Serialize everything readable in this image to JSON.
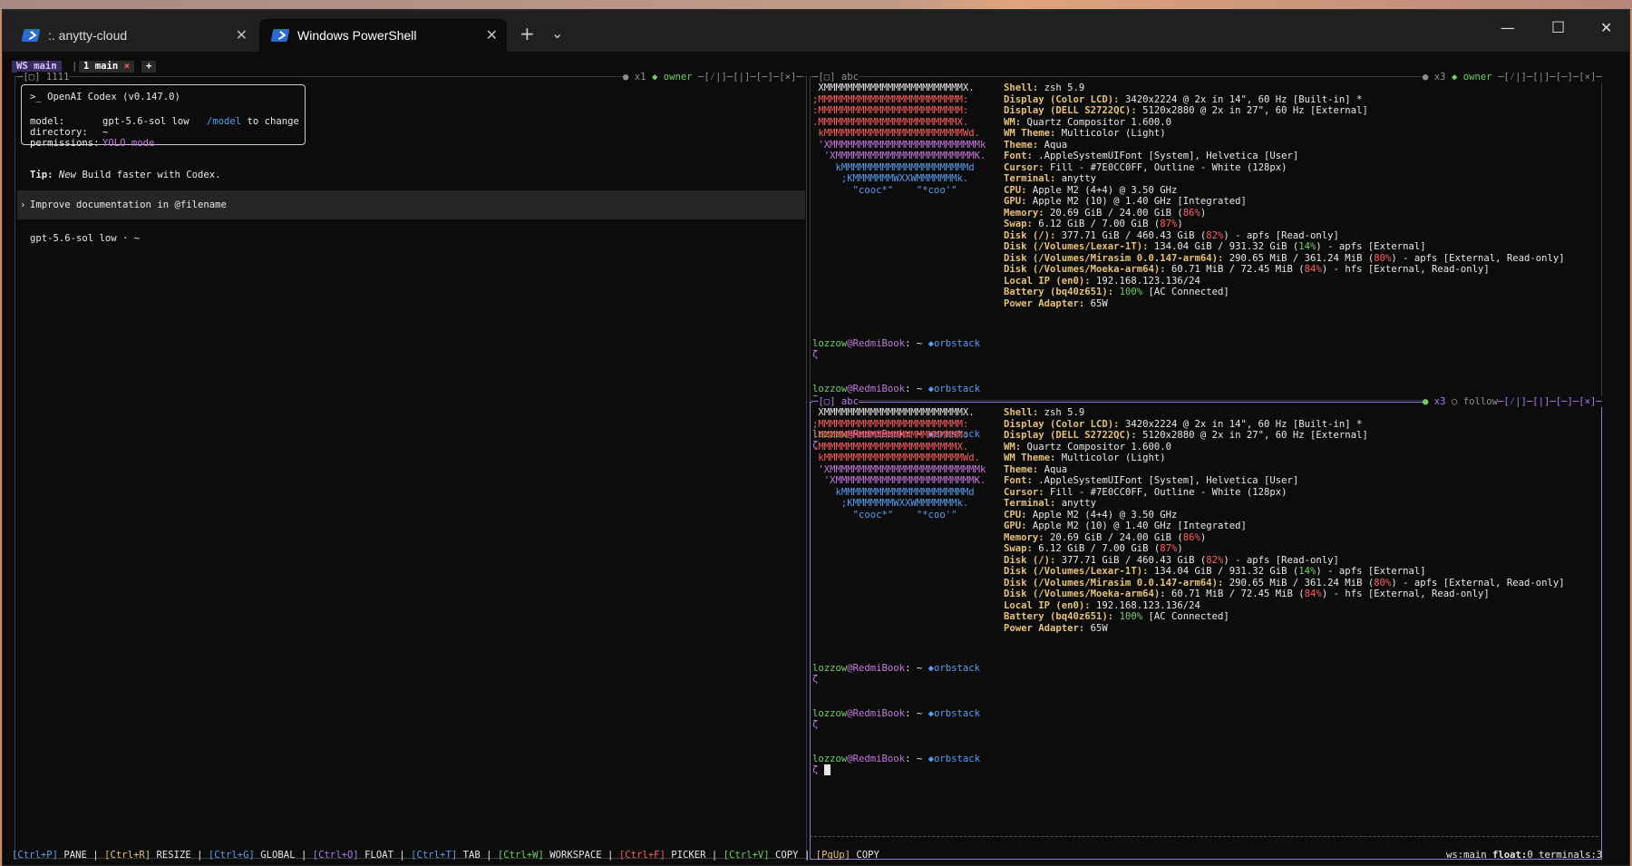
{
  "tabs": [
    {
      "label": "anytty-cloud",
      "prefix": ":."
    },
    {
      "label": "Windows PowerShell"
    }
  ],
  "icons": {
    "tab_close": "✕",
    "new_tab": "+",
    "dropdown": "⌄",
    "minimize": "—",
    "maximize": "☐",
    "close": "✕"
  },
  "workspace": {
    "ws_label": "WS main",
    "sep": "|",
    "tab_label": "1 main",
    "tab_close": "×",
    "add": "+"
  },
  "left_pane": {
    "title": "─[▢] 1111",
    "status_dot": "●",
    "meta": "x1",
    "role_glyph": "◆",
    "role": "owner",
    "controls": "─[⁄|]─[|]─[─]─[×]─",
    "codex": {
      "prompt": ">_",
      "title": "OpenAI Codex (v0.147.0)",
      "model_key": "model:",
      "model_val": "gpt-5.6-sol low",
      "model_cmd": "/model",
      "model_hint": "to change",
      "dir_key": "directory:",
      "dir_val": "~",
      "perm_key": "permissions:",
      "perm_val": "YOLO mode"
    },
    "tip_key": "Tip:",
    "tip_new": "New",
    "tip_text": "Build faster with Codex.",
    "suggest_chevron": "›",
    "suggestion": "Improve documentation in @filename",
    "footer": "gpt-5.6-sol low · ~"
  },
  "right_top": {
    "title": "─[▢] abc",
    "status_dot": "●",
    "meta": "x3",
    "role_glyph": "◆",
    "role": "owner",
    "controls": "─[⁄|]─[|]─[─]─[×]─"
  },
  "right_bottom": {
    "title": "─[▢] abc",
    "status_dot": "●",
    "meta": "x3",
    "role_glyph": "○",
    "role": "follow",
    "controls": "─[⁄|]─[|]─[─]─[×]─"
  },
  "ascii": [
    {
      "t": " XMMMMMMMMMMMMMMMMMMMMMMMMX.",
      "c": "white"
    },
    {
      "t": ";MMMMMMMMMMMMMMMMMMMMMMMMM:",
      "c": "red"
    },
    {
      "t": ":MMMMMMMMMMMMMMMMMMMMMMMMM:",
      "c": "red"
    },
    {
      "t": ".MMMMMMMMMMMMMMMMMMMMMMMMX.",
      "c": "red"
    },
    {
      "t": " kMMMMMMMMMMMMMMMMMMMMMMMMWd.",
      "c": "red"
    },
    {
      "t": " 'XMMMMMMMMMMMMMMMMMMMMMMMMMMk",
      "c": "mag"
    },
    {
      "t": "  'XMMMMMMMMMMMMMMMMMMMMMMMMK.",
      "c": "mag"
    },
    {
      "t": "    kMMMMMMMMMMMMMMMMMMMMMMd",
      "c": "blu"
    },
    {
      "t": "     ;KMMMMMMMWXXWMMMMMMMk.",
      "c": "blu"
    },
    {
      "t": "       \"cooc*\"    \"*coo'\"",
      "c": "blu"
    }
  ],
  "sysinfo": [
    {
      "k": "Shell:",
      "v": " zsh 5.9"
    },
    {
      "k": "Display (Color LCD):",
      "v": " 3420x2224 @ 2x in 14\", 60 Hz [Built-in] *"
    },
    {
      "k": "Display (DELL S2722QC):",
      "v": " 5120x2880 @ 2x in 27\", 60 Hz [External]"
    },
    {
      "k": "WM:",
      "v": " Quartz Compositor 1.600.0"
    },
    {
      "k": "WM Theme:",
      "v": " Multicolor (Light)"
    },
    {
      "k": "Theme:",
      "v": " Aqua"
    },
    {
      "k": "Font:",
      "v": " .AppleSystemUIFont [System], Helvetica [User]"
    },
    {
      "k": "Cursor:",
      "v": " Fill - #7E0CC0FF, Outline - White (128px)"
    },
    {
      "k": "Terminal:",
      "v": " anytty"
    },
    {
      "k": "CPU:",
      "v": " Apple M2 (4+4) @ 3.50 GHz"
    },
    {
      "k": "GPU:",
      "v": " Apple M2 (10) @ 1.40 GHz [Integrated]"
    },
    {
      "k": "Memory:",
      "v": " 20.69 GiB / 24.00 GiB (",
      "p": "86%",
      "pc": "red",
      "e": ")"
    },
    {
      "k": "Swap:",
      "v": " 6.12 GiB / 7.00 GiB (",
      "p": "87%",
      "pc": "red",
      "e": ")"
    },
    {
      "k": "Disk (/):",
      "v": " 377.71 GiB / 460.43 GiB (",
      "p": "82%",
      "pc": "red",
      "e": ") - apfs [Read-only]"
    },
    {
      "k": "Disk (/Volumes/Lexar-1T):",
      "v": " 134.04 GiB / 931.32 GiB (",
      "p": "14%",
      "pc": "grn",
      "e": ") - apfs [External]"
    },
    {
      "k": "Disk (/Volumes/Mirasim 0.0.147-arm64):",
      "v": " 290.65 MiB / 361.24 MiB (",
      "p": "80%",
      "pc": "red",
      "e": ") - apfs [External, Read-only]"
    },
    {
      "k": "Disk (/Volumes/Moeka-arm64):",
      "v": " 60.71 MiB / 72.45 MiB (",
      "p": "84%",
      "pc": "red",
      "e": ") - hfs [External, Read-only]"
    },
    {
      "k": "Local IP (en0):",
      "v": " 192.168.123.136/24"
    },
    {
      "k": "Battery (bq40z651):",
      "v": " ",
      "p": "100%",
      "pc": "grn",
      "e": " [AC Connected]"
    },
    {
      "k": "Power Adapter:",
      "v": " 65W"
    }
  ],
  "prompt": {
    "user": "lozzow",
    "host": "@RedmiBook",
    "sep": ":",
    "path": " ~ ",
    "branch_glyph": "◆",
    "branch": "orbstack",
    "caret": "ζ"
  },
  "statusbar": {
    "items": [
      {
        "key": "[Ctrl+P]",
        "kc": "blu",
        "label": "PANE"
      },
      {
        "key": "[Ctrl+R]",
        "kc": "yel",
        "label": "RESIZE"
      },
      {
        "key": "[Ctrl+G]",
        "kc": "blu",
        "label": "GLOBAL"
      },
      {
        "key": "[Ctrl+O]",
        "kc": "pur",
        "label": "FLOAT"
      },
      {
        "key": "[Ctrl+T]",
        "kc": "blu",
        "label": "TAB"
      },
      {
        "key": "[Ctrl+W]",
        "kc": "grn",
        "label": "WORKSPACE"
      },
      {
        "key": "[Ctrl+F]",
        "kc": "red",
        "label": "PICKER"
      },
      {
        "key": "[Ctrl+V]",
        "kc": "grn",
        "label": "COPY"
      },
      {
        "key": "[PgUp]",
        "kc": "yel",
        "label": "COPY"
      }
    ],
    "sep": "|",
    "right_ws": "ws:main",
    "right_float_key": "float:",
    "right_float_val": "0",
    "right_terms": "terminals:3"
  },
  "colors": {
    "accent": "#9a7ad8",
    "key_yellow": "#e5c07b",
    "green": "#6fcf62",
    "blue": "#5b9cf0",
    "red": "#ff5f5f"
  }
}
